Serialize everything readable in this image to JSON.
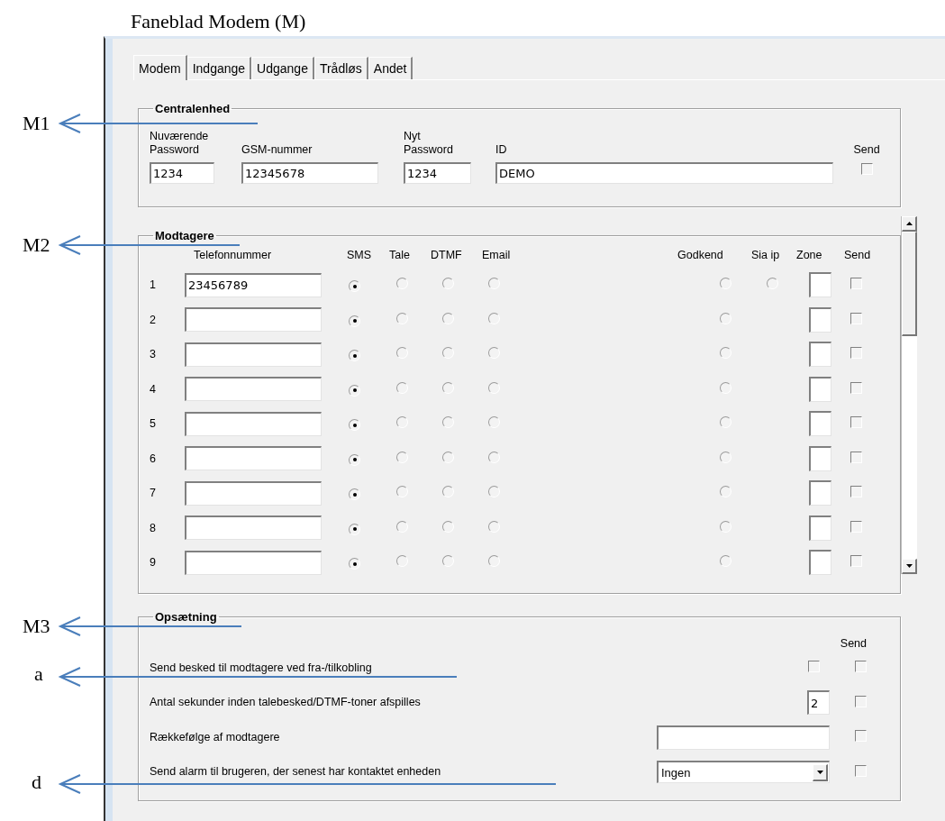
{
  "caption": "Faneblad Modem (M)",
  "tabs": [
    {
      "label": "Modem",
      "selected": true
    },
    {
      "label": "Indgange",
      "selected": false
    },
    {
      "label": "Udgange",
      "selected": false
    },
    {
      "label": "Trådløs",
      "selected": false
    },
    {
      "label": "Andet",
      "selected": false
    }
  ],
  "central": {
    "title": "Centralenhed",
    "fields": [
      {
        "label": "Nuværende\nPassword",
        "value": "1234"
      },
      {
        "label": "GSM-nummer",
        "value": "12345678"
      },
      {
        "label": "Nyt\nPassword",
        "value": "1234"
      },
      {
        "label": "ID",
        "value": "DEMO"
      }
    ],
    "send": {
      "label": "Send",
      "checked": false
    }
  },
  "recipients": {
    "title": "Modtagere",
    "columns": [
      "Telefonnummer",
      "SMS",
      "Tale",
      "DTMF",
      "Email",
      "Godkend",
      "Sia ip",
      "Zone",
      "Send"
    ],
    "rows": [
      {
        "number": "1",
        "phone": "23456789",
        "options": [
          {
            "selected": true
          },
          {
            "selected": false
          },
          {
            "selected": false
          },
          {
            "selected": false
          }
        ],
        "approve": false,
        "sia_ip": false,
        "send": false
      },
      {
        "number": "2",
        "options": [
          {
            "selected": true
          },
          {
            "selected": false
          },
          {
            "selected": false
          },
          {
            "selected": false
          }
        ],
        "approve": false,
        "send": false
      },
      {
        "number": "3",
        "options": [
          {
            "selected": true
          },
          {
            "selected": false
          },
          {
            "selected": false
          },
          {
            "selected": false
          }
        ],
        "approve": false,
        "send": false
      },
      {
        "number": "4",
        "options": [
          {
            "selected": true
          },
          {
            "selected": false
          },
          {
            "selected": false
          },
          {
            "selected": false
          }
        ],
        "approve": false,
        "send": false
      },
      {
        "number": "5",
        "options": [
          {
            "selected": true
          },
          {
            "selected": false
          },
          {
            "selected": false
          },
          {
            "selected": false
          }
        ],
        "approve": false,
        "send": false
      },
      {
        "number": "6",
        "options": [
          {
            "selected": true
          },
          {
            "selected": false
          },
          {
            "selected": false
          },
          {
            "selected": false
          }
        ],
        "approve": false,
        "send": false
      },
      {
        "number": "7",
        "options": [
          {
            "selected": true
          },
          {
            "selected": false
          },
          {
            "selected": false
          },
          {
            "selected": false
          }
        ],
        "approve": false,
        "send": false
      },
      {
        "number": "8",
        "options": [
          {
            "selected": true
          },
          {
            "selected": false
          },
          {
            "selected": false
          },
          {
            "selected": false
          }
        ],
        "approve": false,
        "send": false
      },
      {
        "number": "9",
        "options": [
          {
            "selected": true
          },
          {
            "selected": false
          },
          {
            "selected": false
          },
          {
            "selected": false
          }
        ],
        "approve": false,
        "send": false
      }
    ]
  },
  "setup": {
    "title": "Opsætning",
    "send_header": "Send",
    "rows": [
      {
        "kind": "checkbox",
        "label": "Send besked til modtagere ved fra-/tilkobling",
        "checked": false,
        "send": false
      },
      {
        "kind": "number",
        "label": "Antal sekunder inden talebesked/DTMF-toner afspilles",
        "value": "2",
        "send": false
      },
      {
        "kind": "text",
        "label": "Rækkefølge af modtagere",
        "send": false
      },
      {
        "kind": "select",
        "label": "Send alarm til brugeren, der senest har kontaktet enheden",
        "value": "Ingen",
        "send": false
      }
    ]
  },
  "annotations": [
    {
      "label": "M1"
    },
    {
      "label": "M2"
    },
    {
      "label": "M3"
    },
    {
      "label": "a"
    },
    {
      "label": "d"
    }
  ]
}
